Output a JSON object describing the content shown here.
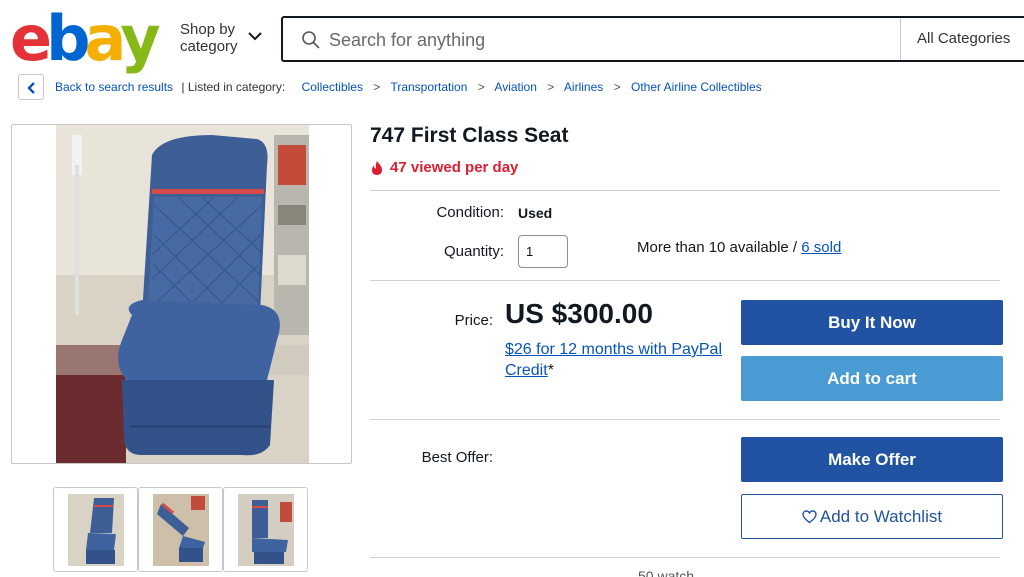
{
  "header": {
    "logo_letters": [
      "e",
      "b",
      "a",
      "y"
    ],
    "logo_colors": [
      "#e53238",
      "#0064d2",
      "#f5af02",
      "#86b817"
    ],
    "shop_by_line1": "Shop by",
    "shop_by_line2": "category",
    "search_placeholder": "Search for anything",
    "category_select": "All Categories"
  },
  "breadcrumb": {
    "back_label": "Back to search results",
    "listed_label": "| Listed in category:",
    "items": [
      "Collectibles",
      "Transportation",
      "Aviation",
      "Airlines",
      "Other Airline Collectibles"
    ],
    "separator": ">"
  },
  "listing": {
    "title": "747 First Class Seat",
    "viewed": "47 viewed per day",
    "condition_label": "Condition:",
    "condition_value": "Used",
    "quantity_label": "Quantity:",
    "quantity_value": "1",
    "availability_text": "More than 10 available / ",
    "sold_link": "6 sold",
    "price_label": "Price:",
    "price_value": "US $300.00",
    "credit_link": "$26 for 12 months with PayPal Credit",
    "credit_suffix": "*",
    "best_offer_label": "Best Offer:",
    "buttons": {
      "buy_now": "Buy It Now",
      "add_to_cart": "Add to cart",
      "make_offer": "Make Offer",
      "add_to_watchlist": "Add to Watchlist"
    },
    "cutoff_text": "50 watch"
  },
  "colors": {
    "accent_blue": "#2153a2",
    "cart_blue": "#4a9bd4",
    "link_blue": "#0654ba",
    "alert_red": "#dd1e31"
  }
}
